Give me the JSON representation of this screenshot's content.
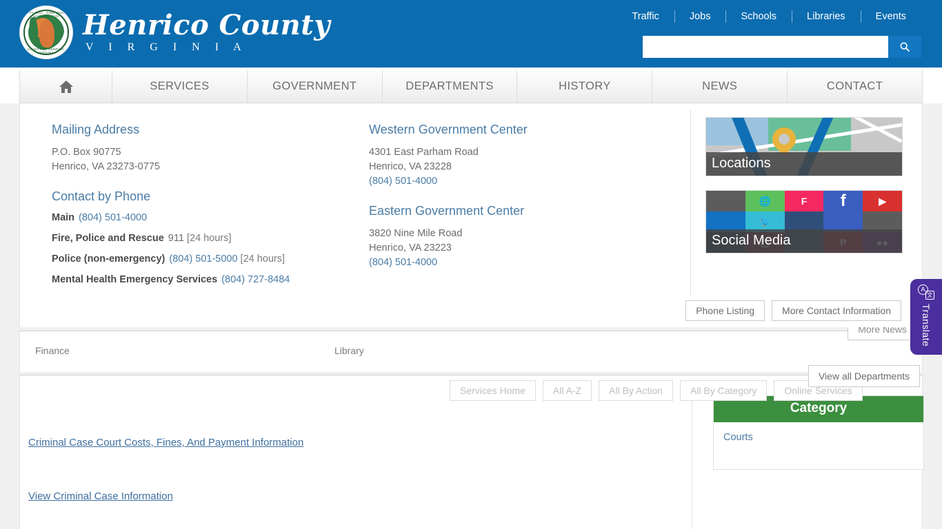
{
  "header": {
    "brand_name": "Henrico County",
    "brand_sub": "V I R G I N I A",
    "seal_top_text": "CITY 1611 · JUNE 1634 · HANOVER 1720",
    "seal_bottom_text": "COUNTY OF HENRICO, VIRGINIA",
    "util_nav": [
      {
        "label": "Traffic"
      },
      {
        "label": "Jobs"
      },
      {
        "label": "Schools"
      },
      {
        "label": "Libraries"
      },
      {
        "label": "Events"
      }
    ],
    "search": {
      "value": "",
      "placeholder": "",
      "icon": "search-icon"
    }
  },
  "main_nav": [
    {
      "label": "",
      "icon": "home-icon"
    },
    {
      "label": "SERVICES"
    },
    {
      "label": "GOVERNMENT"
    },
    {
      "label": "DEPARTMENTS"
    },
    {
      "label": "HISTORY"
    },
    {
      "label": "NEWS"
    },
    {
      "label": "CONTACT"
    }
  ],
  "contact": {
    "mailing": {
      "heading": "Mailing Address",
      "line1": "P.O. Box 90775",
      "line2": "Henrico, VA 23273-0775"
    },
    "phone_heading": "Contact by Phone",
    "phones": [
      {
        "label": "Main",
        "number": "(804) 501-4000",
        "note": ""
      },
      {
        "label": "Fire, Police and Rescue",
        "number": "911",
        "note": "[24 hours]"
      },
      {
        "label": "Police (non-emergency)",
        "number": "(804) 501-5000",
        "note": "[24 hours]"
      },
      {
        "label": "Mental Health Emergency Services",
        "number": "(804) 727-8484",
        "note": ""
      }
    ],
    "western": {
      "heading": "Western Government Center",
      "line1": "4301 East Parham Road",
      "line2": "Henrico, VA 23228",
      "phone": "(804) 501-4000"
    },
    "eastern": {
      "heading": "Eastern Government Center",
      "line1": "3820 Nine Mile Road",
      "line2": "Henrico, VA 23223",
      "phone": "(804) 501-4000"
    },
    "tiles": [
      {
        "label": "Locations",
        "icon": "map-pin-icon"
      },
      {
        "label": "Social Media",
        "icon": "social-grid-icon"
      }
    ],
    "buttons": [
      {
        "label": "Phone Listing"
      },
      {
        "label": "More Contact Information"
      }
    ]
  },
  "behind": {
    "more_news_label": "More News",
    "departments": [
      {
        "label": "Finance"
      },
      {
        "label": "Library"
      }
    ],
    "view_all_departments_label": "View all Departments",
    "service_buttons": [
      {
        "label": "Services Home"
      },
      {
        "label": "All A-Z"
      },
      {
        "label": "All By Action"
      },
      {
        "label": "All By Category"
      },
      {
        "label": "Online Services"
      }
    ]
  },
  "results": {
    "links": [
      {
        "label": "Criminal Case Court Costs, Fines, And Payment Information"
      },
      {
        "label": "View Criminal Case Information"
      }
    ]
  },
  "category_panel": {
    "title": "Category",
    "items": [
      {
        "label": "Courts"
      }
    ]
  },
  "translate": {
    "label": "Translate",
    "icon": "translate-icon",
    "icon_a": "A",
    "icon_zh": "文"
  },
  "colors": {
    "header_blue": "#0b6cb0",
    "search_btn_blue": "#1277c0",
    "link_blue": "#4a7ca6",
    "category_green": "#3c8f3f",
    "translate_purple": "#4b2f9e"
  }
}
